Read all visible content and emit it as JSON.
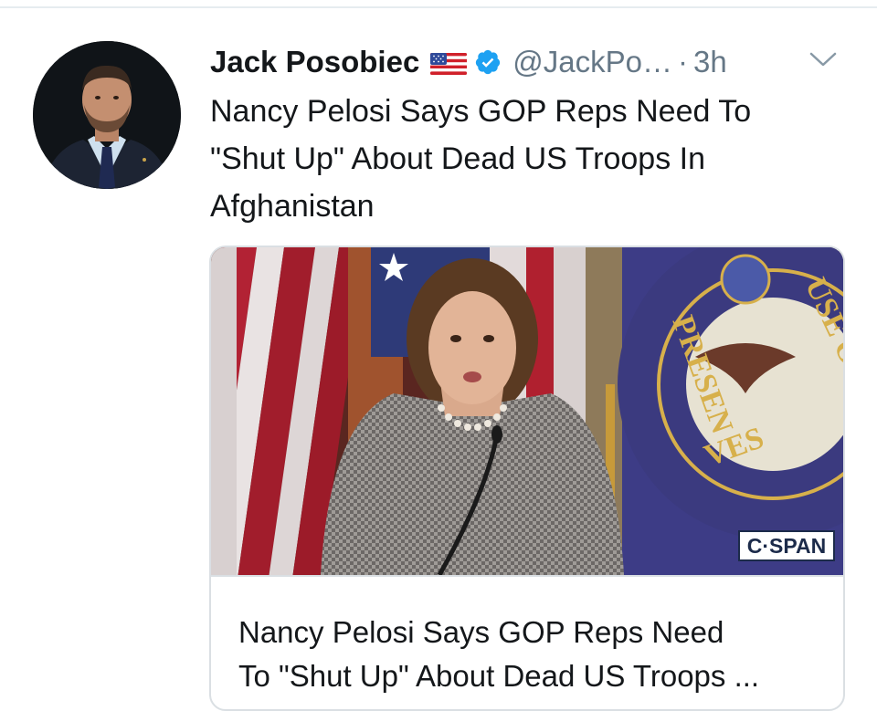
{
  "tweet": {
    "author_name": "Jack Posobiec",
    "flag_icon": "us-flag-icon",
    "verified_icon": "verified-badge-icon",
    "handle": "@JackPo…",
    "separator": "·",
    "time": "3h",
    "menu_icon": "chevron-down-icon",
    "text_lines": [
      "Nancy Pelosi Says GOP Reps Need To",
      "\"Shut Up\" About Dead US Troops In",
      "Afghanistan"
    ]
  },
  "card": {
    "image_badge": "C·SPAN",
    "title_lines": [
      "Nancy Pelosi Says GOP Reps Need",
      "To \"Shut Up\" About Dead US Troops ..."
    ]
  },
  "colors": {
    "text_primary": "#14171a",
    "text_secondary": "#657786",
    "verified_blue": "#1da1f2",
    "border": "#dadfe3"
  }
}
